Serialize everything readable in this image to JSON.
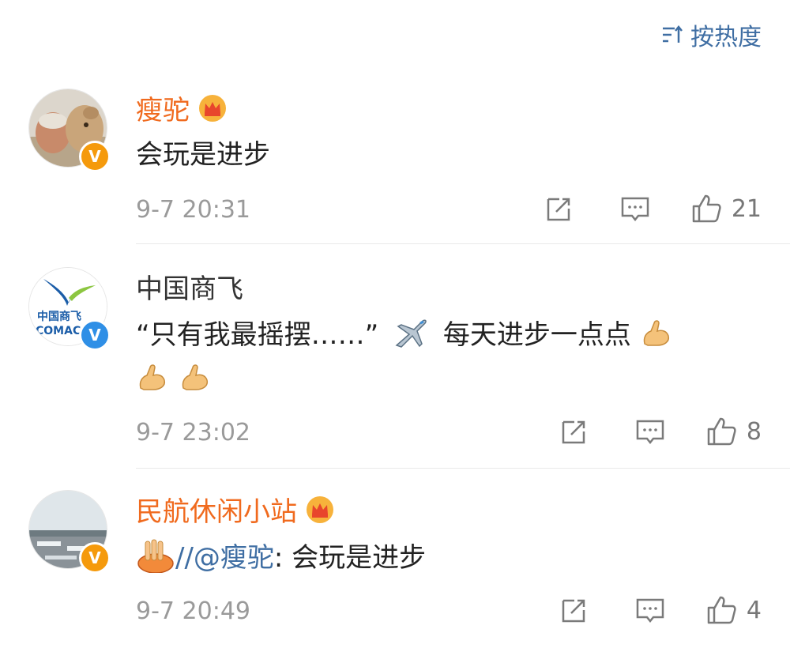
{
  "sort": {
    "label": "按热度"
  },
  "comments": [
    {
      "name": "瘦驼",
      "text": "会玩是进步",
      "time": "9-7 20:31",
      "likes": "21",
      "verify": "V"
    },
    {
      "name": "中国商飞",
      "text_quote": "“只有我最摇摆……”",
      "text_after": "每天进步一点点",
      "time": "9-7 23:02",
      "likes": "8",
      "verify": "V",
      "avatar_text_top": "中国商飞",
      "avatar_text_bottom": "COMAC"
    },
    {
      "name": "民航休闲小站",
      "mention": "//@瘦驼",
      "text": ": 会玩是进步",
      "time": "9-7 20:49",
      "likes": "4",
      "verify": "V"
    }
  ],
  "colors": {
    "vip_name": "#f06a1e",
    "link": "#3f6ea3",
    "badge_orange": "#f59a0c",
    "badge_blue": "#2f8fe6",
    "meta_gray": "#9a9a9a"
  }
}
